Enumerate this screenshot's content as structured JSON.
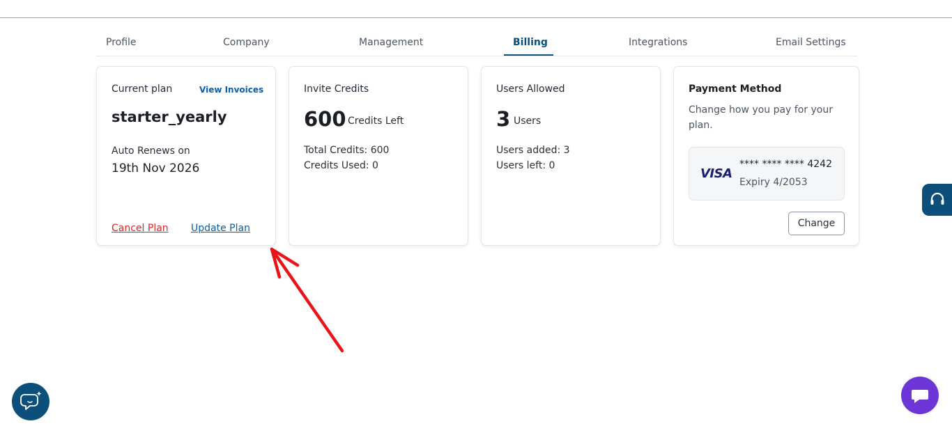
{
  "tabs": [
    {
      "label": "Profile"
    },
    {
      "label": "Company"
    },
    {
      "label": "Management"
    },
    {
      "label": "Billing",
      "active": true
    },
    {
      "label": "Integrations"
    },
    {
      "label": "Email Settings"
    }
  ],
  "current_plan": {
    "heading": "Current plan",
    "view_invoices": "View Invoices",
    "plan_name": "starter_yearly",
    "renew_label": "Auto Renews on",
    "renew_date": "19th Nov 2026",
    "cancel_label": "Cancel Plan",
    "update_label": "Update Plan"
  },
  "invite_credits": {
    "heading": "Invite Credits",
    "value": "600",
    "unit": "Credits Left",
    "total": "Total Credits: 600",
    "used": "Credits Used: 0"
  },
  "users_allowed": {
    "heading": "Users Allowed",
    "value": "3",
    "unit": "Users",
    "added": "Users added: 3",
    "left": "Users left: 0"
  },
  "payment_method": {
    "heading": "Payment Method",
    "description": "Change how you pay for your plan.",
    "card_brand": "VISA",
    "card_number": "**** **** **** 4242",
    "expiry": "Expiry 4/2053",
    "change_label": "Change"
  },
  "icons": {
    "support": "headset-icon",
    "chat_left": "chat-sparkle-icon",
    "chat_right": "chat-bubble-icon"
  },
  "colors": {
    "primary": "#0b4f7a",
    "link": "#0b5ea8",
    "danger": "#dc2626",
    "chat_accent": "#6d35d8",
    "annotation_arrow": "#e8141a"
  }
}
